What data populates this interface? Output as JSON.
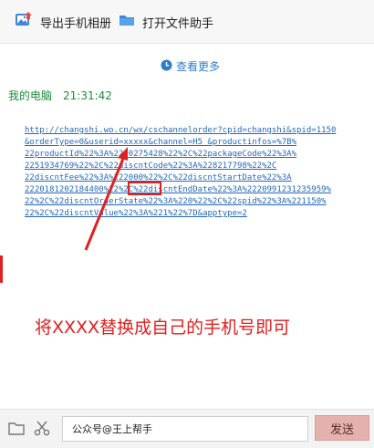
{
  "toolbar": {
    "export_album": "导出手机相册",
    "open_file_helper": "打开文件助手"
  },
  "chat": {
    "view_more": "查看更多",
    "sender": "我的电脑",
    "time": "21:31:42",
    "message_lines": [
      "http://changshi.wo.cn/wx/cschannelorder?cpid=changshi&spid=1150",
      "&orderType=0&userid=xxxxx&channel=H5 &productinfos=%7B%",
      "22productId%22%3A%2290275428%22%2C%22packageCode%22%3A%",
      "2251934769%22%2C%22discntCode%22%3A%228217798%22%2C",
      "22discntFee%22%3A%222000%22%2C%22discntStartDate%22%3A",
      "2220181202184400%22%2C%22discntEndDate%22%3A%2220991231235959%",
      "22%2C%22discntOrderState%22%3A%220%22%2C%22spid%22%3A%221150%",
      "22%2C%22discntValue%22%3A%221%22%7D&apptype=2"
    ]
  },
  "annotation": {
    "text": "将XXXX替换成自己的手机号即可",
    "color": "#e02020"
  },
  "input": {
    "value": "公众号@王上帮手"
  },
  "send_label": "发送",
  "colors": {
    "link": "#2668b8",
    "sender": "#1f8a3c",
    "send_button": "#e5b1ae"
  },
  "icons": [
    "image-icon",
    "folder-icon",
    "clock-icon",
    "scissors-icon"
  ]
}
